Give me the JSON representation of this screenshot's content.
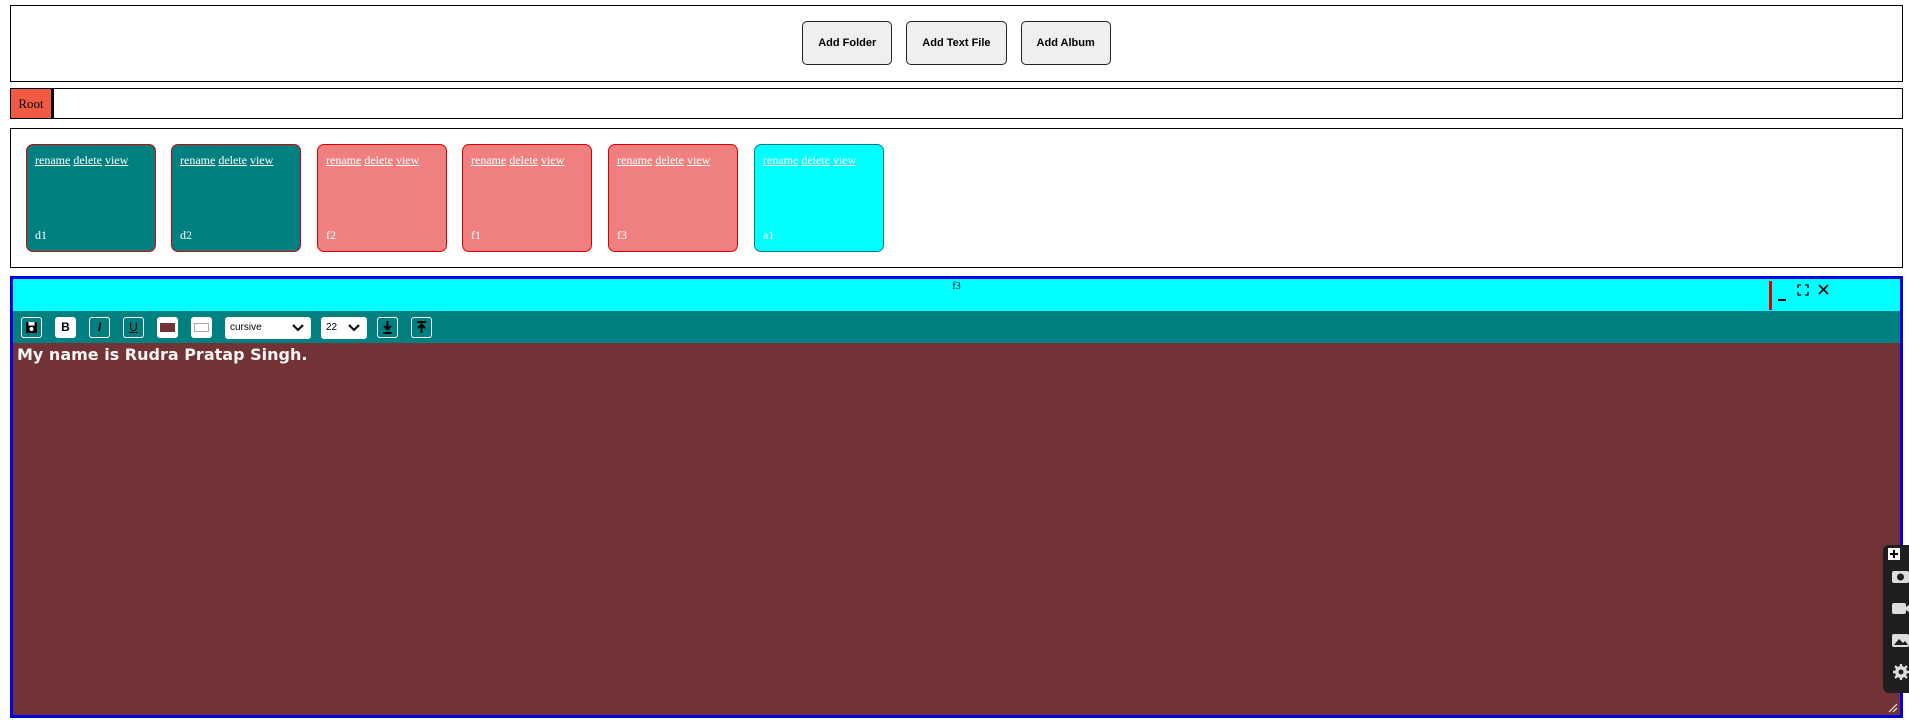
{
  "toolbar": {
    "buttons": [
      {
        "label": "Add Folder"
      },
      {
        "label": "Add Text File"
      },
      {
        "label": "Add Album"
      }
    ]
  },
  "breadcrumb": {
    "root": "Root"
  },
  "items": [
    {
      "type": "folder",
      "name": "d1",
      "actions": [
        "rename",
        "delete",
        "view"
      ]
    },
    {
      "type": "folder",
      "name": "d2",
      "actions": [
        "rename",
        "delete",
        "view"
      ]
    },
    {
      "type": "textfile",
      "name": "f2",
      "actions": [
        "rename",
        "delete",
        "view"
      ]
    },
    {
      "type": "textfile",
      "name": "f1",
      "actions": [
        "rename",
        "delete",
        "view"
      ]
    },
    {
      "type": "textfile",
      "name": "f3",
      "actions": [
        "rename",
        "delete",
        "view"
      ]
    },
    {
      "type": "album",
      "name": "a1",
      "actions": [
        "rename",
        "delete",
        "view"
      ]
    }
  ],
  "editor": {
    "title": "f3",
    "ribbon": {
      "bold_label": "B",
      "italic_label": "I",
      "underline_label": "U",
      "font_family": "cursive",
      "font_size": "22",
      "text_color": "#723336"
    },
    "content": "My name is Rudra Pratap Singh."
  },
  "colors": {
    "folder": "#008080",
    "textfile": "#f08080",
    "album": "#00ffff",
    "editor_bg": "#723336",
    "title_bar": "#00ffff",
    "window_border": "#0000e0",
    "root_crumb": "#f05a43"
  },
  "icons": {
    "save": "save-icon",
    "download": "download-icon",
    "upload": "upload-icon",
    "minimize": "minimize-icon",
    "maximize": "maximize-icon",
    "close": "close-icon",
    "dock": [
      "add-icon",
      "camera-icon",
      "video-icon",
      "image-icon",
      "gear-icon"
    ]
  }
}
